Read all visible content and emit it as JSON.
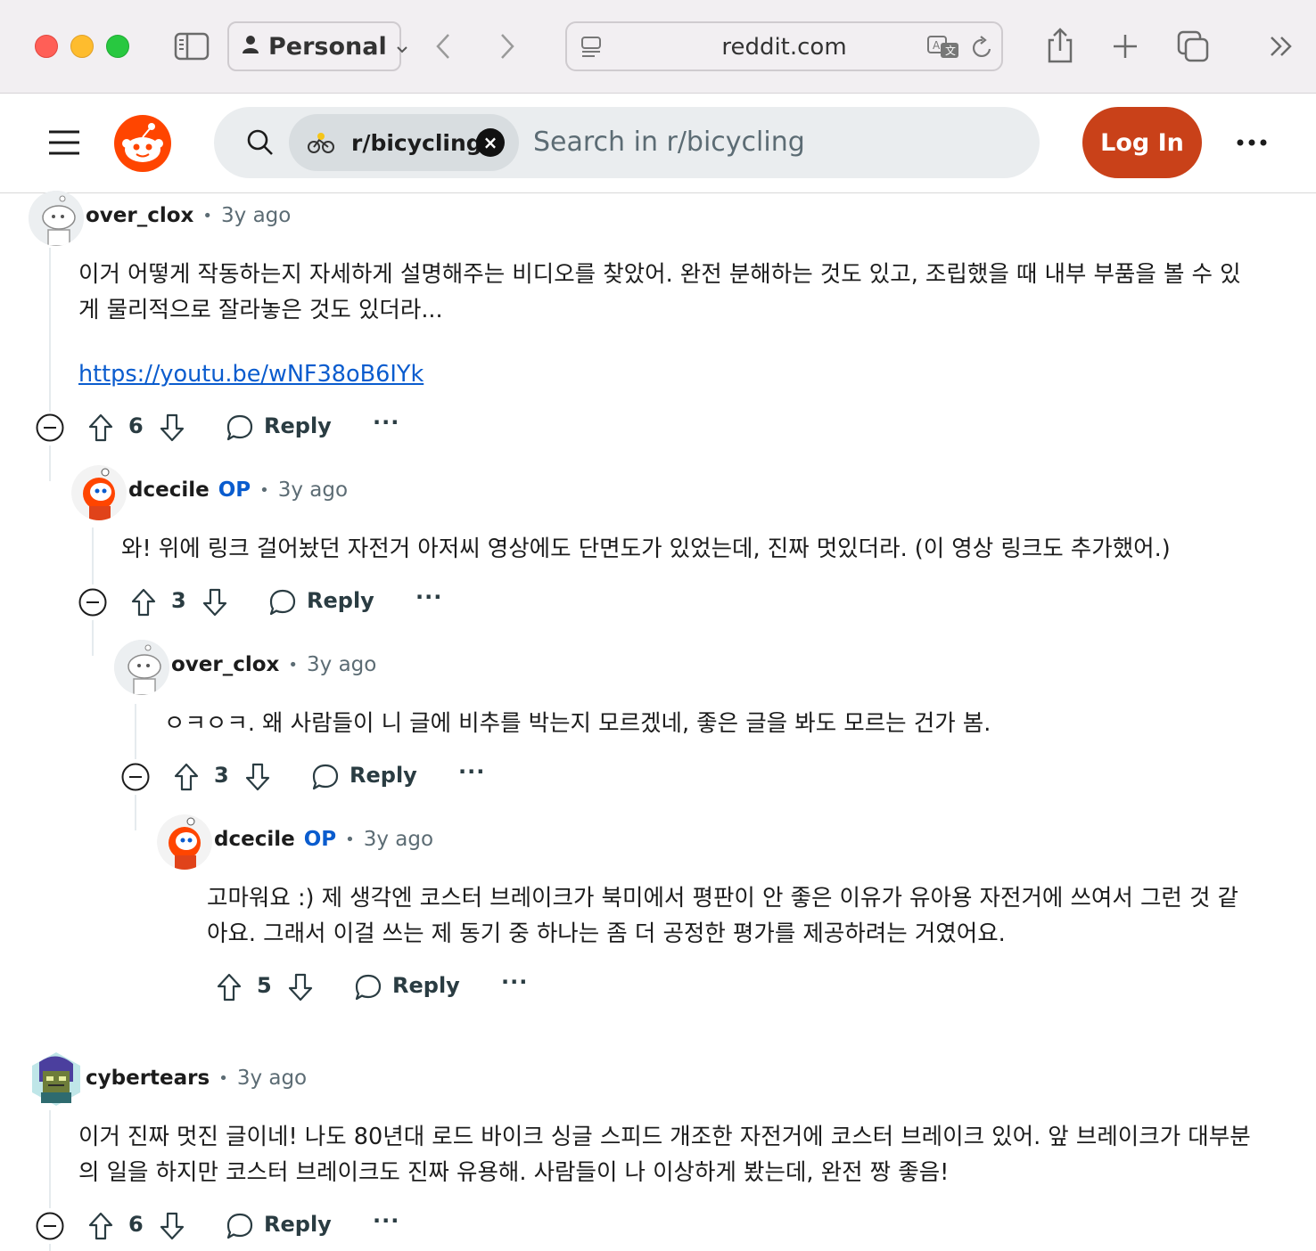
{
  "browser": {
    "profile_label": "Personal",
    "url": "reddit.com"
  },
  "header": {
    "community_chip": "r/bicycling",
    "search_placeholder": "Search in r/bicycling",
    "login_label": "Log In"
  },
  "comments": [
    {
      "user": "over_clox",
      "time": "3y ago",
      "body_lines": [
        "이거 어떻게 작동하는지 자세하게 설명해주는 비디오를 찾았어. 완전 분해하는 것도 있고, 조립했을 때 내부 부품을 볼 수 있",
        "게 물리적으로 잘라놓은 것도 있더라..."
      ],
      "link": "https://youtu.be/wNF38oB6IYk",
      "votes": "6",
      "reply_label": "Reply"
    },
    {
      "user": "dcecile",
      "op_badge": "OP",
      "time": "3y ago",
      "body_lines": [
        "와! 위에 링크 걸어놨던 자전거 아저씨 영상에도 단면도가 있었는데, 진짜 멋있더라. (이 영상 링크도 추가했어.)"
      ],
      "votes": "3",
      "reply_label": "Reply"
    },
    {
      "user": "over_clox",
      "time": "3y ago",
      "body_lines": [
        "ㅇㅋㅇㅋ. 왜 사람들이 니 글에 비추를 박는지 모르겠네, 좋은 글을 봐도 모르는 건가 봄."
      ],
      "votes": "3",
      "reply_label": "Reply"
    },
    {
      "user": "dcecile",
      "op_badge": "OP",
      "time": "3y ago",
      "body_lines": [
        "고마워요 :) 제 생각엔 코스터 브레이크가 북미에서 평판이 안 좋은 이유가 유아용 자전거에 쓰여서 그런 것 같",
        "아요. 그래서 이걸 쓰는 제 동기 중 하나는 좀 더 공정한 평가를 제공하려는 거였어요."
      ],
      "votes": "5",
      "reply_label": "Reply"
    },
    {
      "user": "cybertears",
      "time": "3y ago",
      "body_lines": [
        "이거 진짜 멋진 글이네! 나도 80년대 로드 바이크 싱글 스피드 개조한 자전거에 코스터 브레이크 있어. 앞 브레이크가 대부분",
        "의 일을 하지만 코스터 브레이크도 진짜 유용해. 사람들이 나 이상하게 봤는데, 완전 짱 좋음!"
      ],
      "votes": "6",
      "reply_label": "Reply"
    }
  ]
}
